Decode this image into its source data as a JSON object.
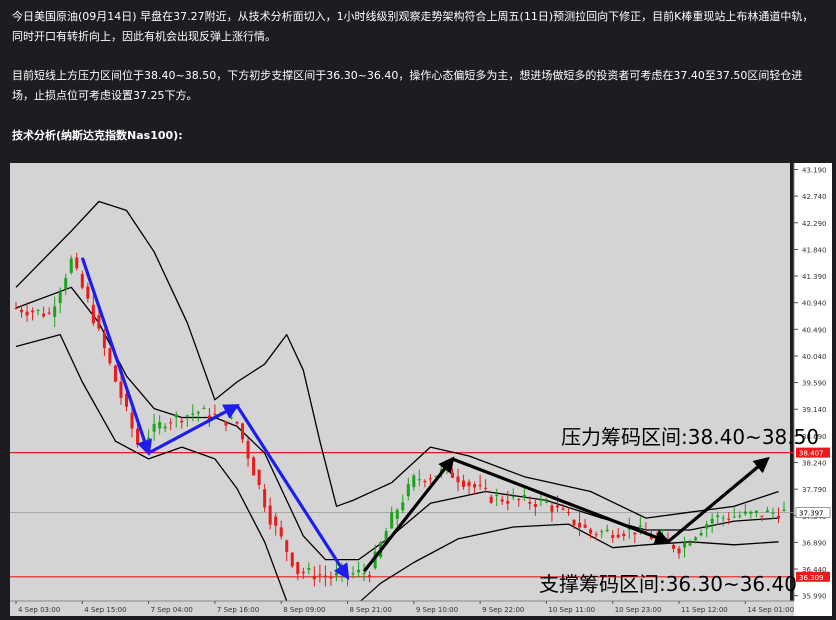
{
  "article": {
    "paragraph_1": "今日美国原油(09月14日) 早盘在37.27附近，从技术分析面切入，1小时线级别观察走势架构符合上周五(11日)预测拉回向下修正，目前K棒重现站上布林通道中轨，同时开口有转折向上，因此有机会出现反弹上涨行情。",
    "paragraph_2": "目前短线上方压力区间位于38.40~38.50，下方初步支撑区间于36.30~36.40，操作心态偏短多为主，想进场做短多的投资者可考虑在37.40至37.50区间轻仓进场，止损点位可考虑设置37.25下方。",
    "section_title": "技术分析(纳斯达克指数Nas100):"
  },
  "colors": {
    "chart_bg": "#d4d4d4",
    "axis_bg": "#ffffff",
    "bull_candle": "#1ba31b",
    "bear_candle": "#e81c1c",
    "band": "#000000",
    "level_line": "#e81c1c",
    "arrow_blue": "#1d1df0",
    "arrow_black": "#000000"
  },
  "chart_data": {
    "type": "candlestick",
    "title": "",
    "ylim": [
      35.9,
      43.3
    ],
    "y_ticks": [
      "43.190",
      "42.740",
      "42.290",
      "41.840",
      "41.390",
      "40.940",
      "40.490",
      "40.040",
      "39.590",
      "39.140",
      "38.690",
      "38.240",
      "37.790",
      "37.340",
      "36.890",
      "36.440",
      "35.990"
    ],
    "x_ticks": [
      "4 Sep 03:00",
      "4 Sep 15:00",
      "7 Sep 04:00",
      "7 Sep 16:00",
      "8 Sep 09:00",
      "8 Sep 21:00",
      "9 Sep 10:00",
      "9 Sep 22:00",
      "10 Sep 11:00",
      "10 Sep 23:00",
      "11 Sep 12:00",
      "14 Sep 01:00"
    ],
    "x_tick_pos": [
      0,
      12,
      24,
      36,
      48,
      60,
      72,
      84,
      96,
      108,
      120,
      132
    ],
    "candle_count": 140,
    "price_path": [
      [
        0,
        40.85
      ],
      [
        6,
        40.75
      ],
      [
        10,
        41.65
      ],
      [
        13,
        40.95
      ],
      [
        22,
        38.55
      ],
      [
        27,
        38.95
      ],
      [
        33,
        39.1
      ],
      [
        40,
        38.9
      ],
      [
        46,
        37.3
      ],
      [
        51,
        36.4
      ],
      [
        57,
        36.3
      ],
      [
        64,
        36.4
      ],
      [
        68,
        37.3
      ],
      [
        72,
        37.95
      ],
      [
        78,
        38.1
      ],
      [
        86,
        37.65
      ],
      [
        96,
        37.55
      ],
      [
        104,
        37.05
      ],
      [
        112,
        37.1
      ],
      [
        120,
        36.8
      ],
      [
        126,
        37.3
      ],
      [
        132,
        37.35
      ],
      [
        138,
        37.4
      ]
    ],
    "bollinger": {
      "upper": [
        [
          0,
          41.2
        ],
        [
          10,
          42.15
        ],
        [
          15,
          42.65
        ],
        [
          20,
          42.5
        ],
        [
          25,
          41.8
        ],
        [
          31,
          40.6
        ],
        [
          36,
          39.3
        ],
        [
          40,
          39.6
        ],
        [
          45,
          39.9
        ],
        [
          49,
          40.4
        ],
        [
          52,
          39.8
        ],
        [
          55,
          38.6
        ],
        [
          58,
          37.5
        ],
        [
          61,
          37.6
        ],
        [
          68,
          37.9
        ],
        [
          75,
          38.5
        ],
        [
          82,
          38.35
        ],
        [
          92,
          38.0
        ],
        [
          104,
          37.75
        ],
        [
          114,
          37.3
        ],
        [
          122,
          37.4
        ],
        [
          130,
          37.5
        ],
        [
          138,
          37.75
        ]
      ],
      "middle": [
        [
          0,
          40.85
        ],
        [
          10,
          41.2
        ],
        [
          15,
          40.6
        ],
        [
          20,
          39.7
        ],
        [
          25,
          39.15
        ],
        [
          30,
          39.0
        ],
        [
          36,
          39.0
        ],
        [
          40,
          38.85
        ],
        [
          45,
          38.4
        ],
        [
          49,
          37.6
        ],
        [
          52,
          37.0
        ],
        [
          56,
          36.6
        ],
        [
          62,
          36.6
        ],
        [
          68,
          37.0
        ],
        [
          75,
          37.55
        ],
        [
          85,
          37.75
        ],
        [
          96,
          37.6
        ],
        [
          106,
          37.3
        ],
        [
          114,
          37.1
        ],
        [
          122,
          37.1
        ],
        [
          130,
          37.25
        ],
        [
          138,
          37.3
        ]
      ],
      "lower": [
        [
          0,
          40.2
        ],
        [
          8,
          40.4
        ],
        [
          12,
          39.6
        ],
        [
          18,
          38.6
        ],
        [
          24,
          38.3
        ],
        [
          30,
          38.5
        ],
        [
          36,
          38.3
        ],
        [
          40,
          37.8
        ],
        [
          45,
          36.9
        ],
        [
          49,
          35.9
        ],
        [
          52,
          35.6
        ],
        [
          56,
          35.4
        ],
        [
          60,
          35.7
        ],
        [
          66,
          36.2
        ],
        [
          72,
          36.55
        ],
        [
          80,
          36.95
        ],
        [
          90,
          37.15
        ],
        [
          100,
          37.2
        ],
        [
          108,
          36.8
        ],
        [
          114,
          36.85
        ],
        [
          122,
          36.9
        ],
        [
          130,
          36.85
        ],
        [
          138,
          36.9
        ]
      ]
    },
    "levels": [
      {
        "value": 38.407,
        "label": "38.407"
      },
      {
        "value": 36.309,
        "label": "36.309"
      }
    ],
    "current_price": {
      "value": 37.397,
      "label": "37.397"
    },
    "annotations": [
      {
        "text": "压力筹码区间:38.40~38.50",
        "anchor_x": 122,
        "anchor_y": 38.55
      },
      {
        "text": "支撑筹码区间:36.30~36.40",
        "anchor_x": 118,
        "anchor_y": 36.07
      }
    ],
    "arrows": [
      {
        "color": "blue",
        "points": [
          [
            12,
            41.7
          ],
          [
            24,
            38.4
          ]
        ]
      },
      {
        "color": "blue",
        "points": [
          [
            24,
            38.4
          ],
          [
            40,
            39.2
          ]
        ]
      },
      {
        "color": "blue",
        "points": [
          [
            40,
            39.2
          ],
          [
            60,
            36.3
          ]
        ]
      },
      {
        "color": "black",
        "points": [
          [
            63,
            36.4
          ],
          [
            79,
            38.3
          ]
        ]
      },
      {
        "color": "black",
        "points": [
          [
            79,
            38.3
          ],
          [
            118,
            36.9
          ]
        ]
      },
      {
        "color": "black",
        "points": [
          [
            118,
            36.9
          ],
          [
            136,
            38.3
          ]
        ]
      }
    ]
  }
}
